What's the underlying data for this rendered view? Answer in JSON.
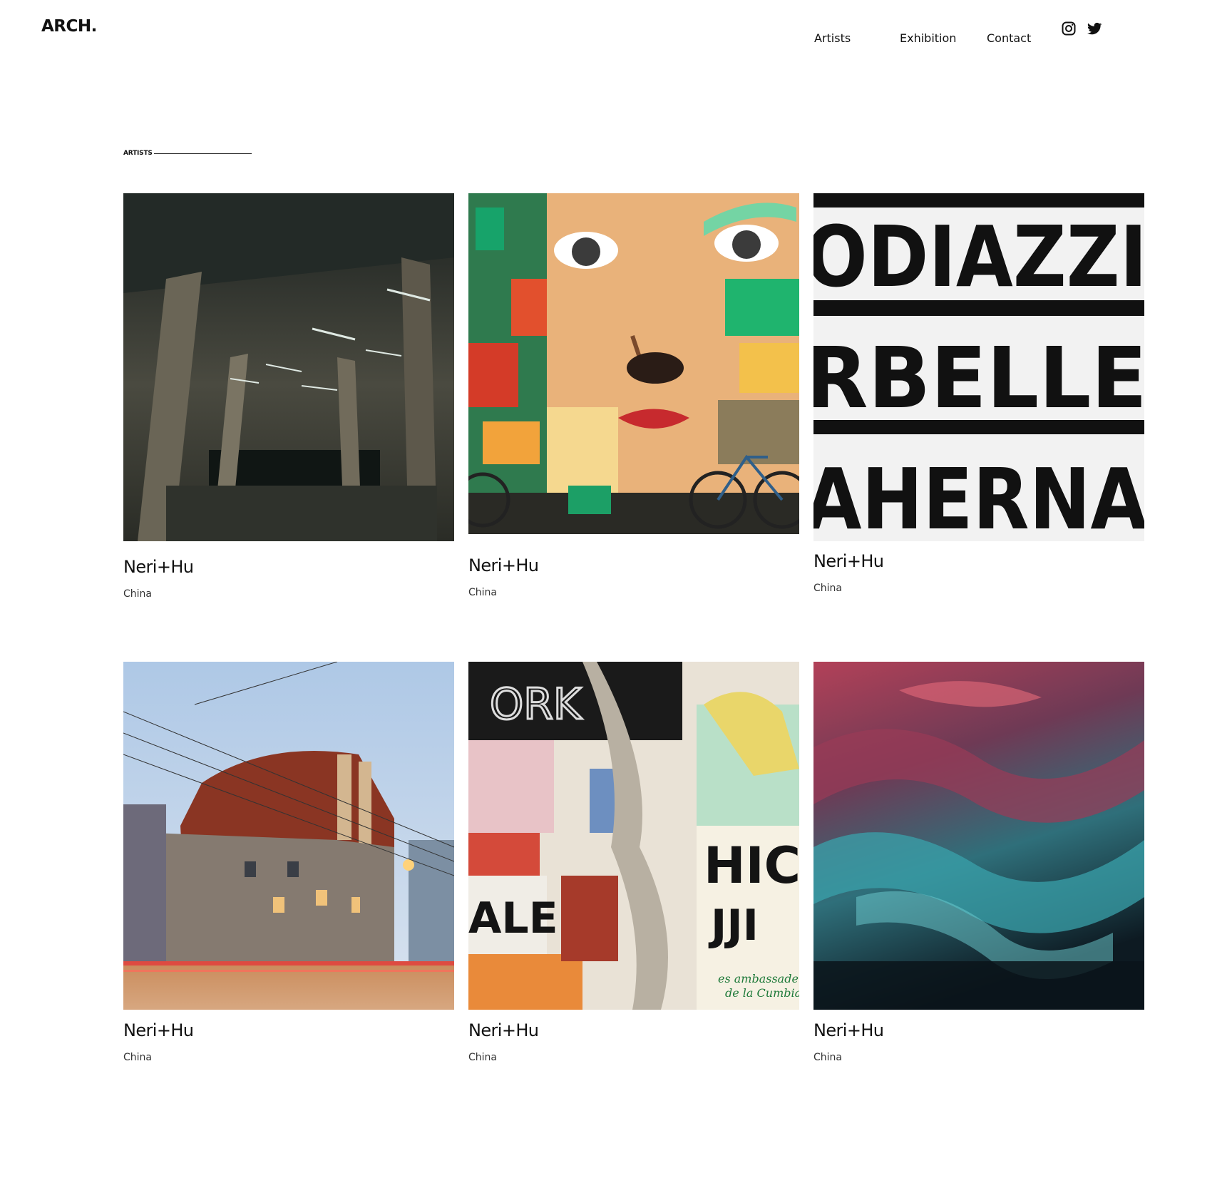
{
  "header": {
    "logo": "ARCH.",
    "nav": [
      {
        "label": "Artists"
      },
      {
        "label": "Exhibition"
      },
      {
        "label": "Contact"
      }
    ],
    "social_icons": [
      "instagram-icon",
      "twitter-icon"
    ]
  },
  "section": {
    "label": "ARTISTS"
  },
  "cards": [
    {
      "name": "Neri+Hu",
      "location": "China",
      "image": "concrete-hall-photo"
    },
    {
      "name": "Neri+Hu",
      "location": "China",
      "image": "street-mural-face-photo"
    },
    {
      "name": "Neri+Hu",
      "location": "China",
      "image": "black-white-lettering-photo"
    },
    {
      "name": "Neri+Hu",
      "location": "China",
      "image": "street-corner-building-photo"
    },
    {
      "name": "Neri+Hu",
      "location": "China",
      "image": "torn-posters-photo"
    },
    {
      "name": "Neri+Hu",
      "location": "China",
      "image": "red-teal-fluid-art-photo"
    }
  ],
  "colors": {
    "background": "#ffffff",
    "text": "#111111",
    "muted_text": "#333333"
  }
}
